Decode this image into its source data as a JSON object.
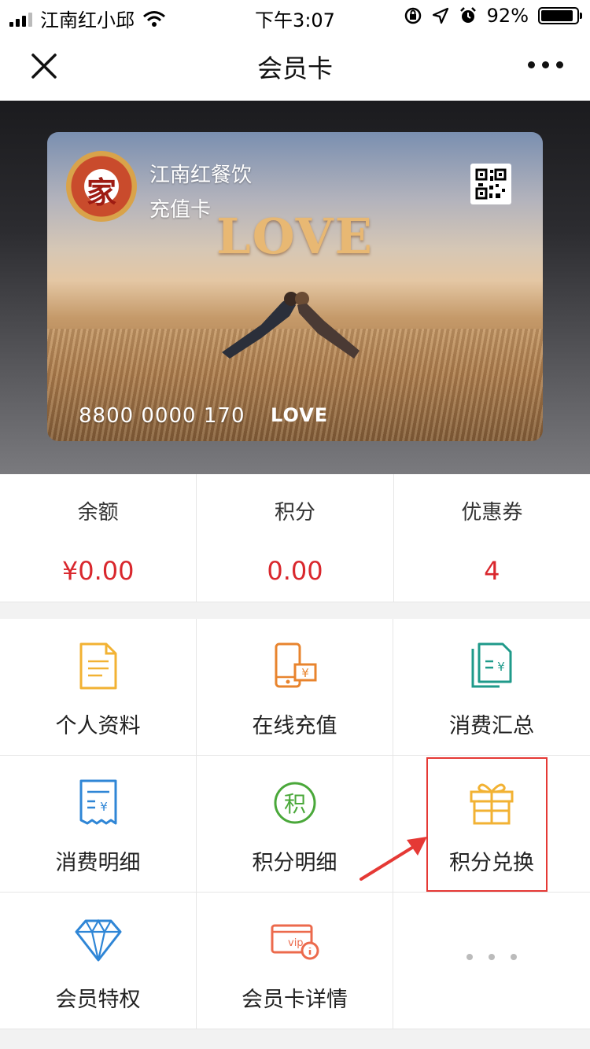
{
  "status_bar": {
    "carrier": "江南红小邱",
    "time": "下午3:07",
    "battery_percent": "92%",
    "battery_level": 0.92,
    "icons": [
      "signal-icon",
      "wifi-icon",
      "rotation-lock-icon",
      "location-icon",
      "alarm-icon",
      "battery-icon"
    ]
  },
  "nav": {
    "title": "会员卡",
    "close_icon": "close-icon",
    "more_icon": "more-icon"
  },
  "card": {
    "merchant_name": "江南红餐饮",
    "card_type": "充值卡",
    "logo_text": "家",
    "art_title": "LOVE",
    "number": "8800 0000 170",
    "brand_mark": "LOVE",
    "qr_icon": "qr-code-icon"
  },
  "stats": [
    {
      "label": "余额",
      "value": "¥0.00"
    },
    {
      "label": "积分",
      "value": "0.00"
    },
    {
      "label": "优惠券",
      "value": "4"
    }
  ],
  "menu": [
    {
      "label": "个人资料",
      "icon": "profile-document-icon"
    },
    {
      "label": "在线充值",
      "icon": "phone-recharge-icon"
    },
    {
      "label": "消费汇总",
      "icon": "consumption-summary-icon"
    },
    {
      "label": "消费明细",
      "icon": "receipt-icon"
    },
    {
      "label": "积分明细",
      "icon": "points-icon"
    },
    {
      "label": "积分兑换",
      "icon": "gift-icon"
    },
    {
      "label": "会员特权",
      "icon": "diamond-icon"
    },
    {
      "label": "会员卡详情",
      "icon": "vip-card-icon"
    },
    {
      "label": "",
      "icon": "more-dots-icon"
    }
  ],
  "colors": {
    "accent_red": "#d9272d",
    "highlight_red": "#e53935",
    "icon_yellow": "#f2b233",
    "icon_orange": "#e8842e",
    "icon_teal": "#1f9a8a",
    "icon_blue": "#2f86d6",
    "icon_green": "#4aa83a",
    "icon_red_orange": "#ec6a4c"
  }
}
